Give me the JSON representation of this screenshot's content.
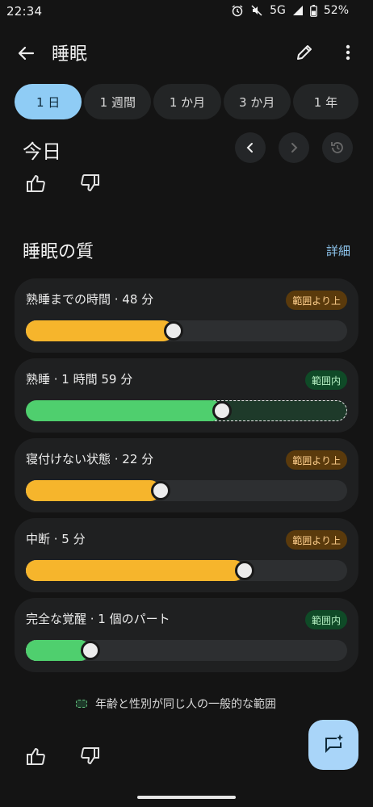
{
  "status_bar": {
    "time": "22:34",
    "network": "5G",
    "battery": "52%"
  },
  "app_bar": {
    "title": "睡眠",
    "back_icon": "arrow-left-icon",
    "edit_icon": "pencil-icon",
    "more_icon": "more-vert-icon"
  },
  "tabs": [
    {
      "label": "1 日",
      "active": true
    },
    {
      "label": "1 週間",
      "active": false
    },
    {
      "label": "1 か月",
      "active": false
    },
    {
      "label": "3 か月",
      "active": false
    },
    {
      "label": "1 年",
      "active": false
    }
  ],
  "date": {
    "title": "今日"
  },
  "section": {
    "title": "睡眠の質",
    "details": "詳細"
  },
  "metrics": [
    {
      "label": "熟睡までの時間 · 48 分",
      "badge": "範囲より上",
      "status": "above",
      "value_fraction": 0.46,
      "range": [
        0.0,
        0.26
      ]
    },
    {
      "label": "熟睡 · 1 時間 59 分",
      "badge": "範囲内",
      "status": "within",
      "value_fraction": 0.61,
      "range": [
        0.5,
        1.0
      ]
    },
    {
      "label": "寝付けない状態 · 22 分",
      "badge": "範囲より上",
      "status": "above",
      "value_fraction": 0.42,
      "range": [
        0.0,
        0.3
      ]
    },
    {
      "label": "中断 · 5 分",
      "badge": "範囲より上",
      "status": "above",
      "value_fraction": 0.68,
      "range": [
        0.0,
        0.5
      ]
    },
    {
      "label": "完全な覚醒 · 1 個のパート",
      "badge": "範囲内",
      "status": "within",
      "value_fraction": 0.2,
      "range": [
        0.0,
        0.2
      ]
    }
  ],
  "legend": {
    "text": "年齢と性別が同じ人の一般的な範囲"
  },
  "colors": {
    "accent": "#8fccf5",
    "above_fill": "#f6b52c",
    "within_fill": "#4fcf6e",
    "above_badge": "#5a3a0c",
    "within_badge": "#0f4a27"
  }
}
